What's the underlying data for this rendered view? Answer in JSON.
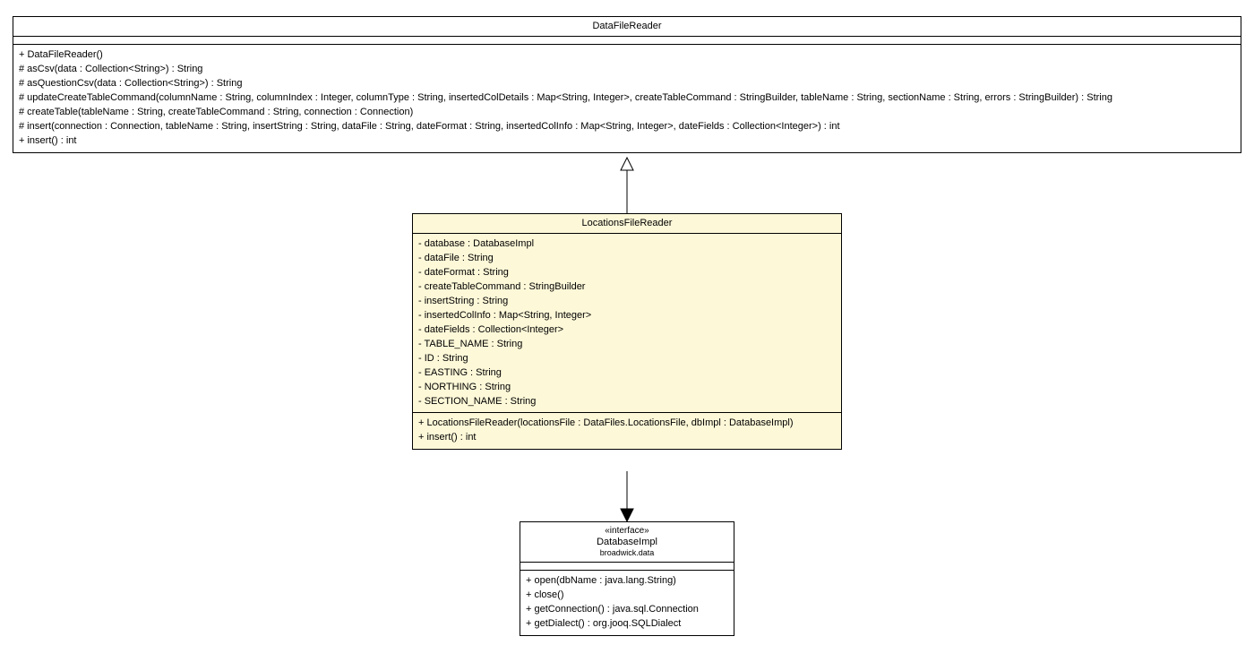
{
  "classes": {
    "dataFileReader": {
      "name": "DataFileReader",
      "attributes": [],
      "operations": [
        "+ DataFileReader()",
        "# asCsv(data : Collection<String>) : String",
        "# asQuestionCsv(data : Collection<String>) : String",
        "# updateCreateTableCommand(columnName : String, columnIndex : Integer, columnType : String, insertedColDetails : Map<String, Integer>, createTableCommand : StringBuilder, tableName : String, sectionName : String, errors : StringBuilder) : String",
        "# createTable(tableName : String, createTableCommand : String, connection : Connection)",
        "# insert(connection : Connection, tableName : String, insertString : String, dataFile : String, dateFormat : String, insertedColInfo : Map<String, Integer>, dateFields : Collection<Integer>) : int",
        "+ insert() : int"
      ]
    },
    "locationsFileReader": {
      "name": "LocationsFileReader",
      "attributes": [
        "- database : DatabaseImpl",
        "- dataFile : String",
        "- dateFormat : String",
        "- createTableCommand : StringBuilder",
        "- insertString : String",
        "- insertedColInfo : Map<String, Integer>",
        "- dateFields : Collection<Integer>",
        "- TABLE_NAME : String",
        "- ID : String",
        "- EASTING : String",
        "- NORTHING : String",
        "- SECTION_NAME : String"
      ],
      "operations": [
        "+ LocationsFileReader(locationsFile : DataFiles.LocationsFile, dbImpl : DatabaseImpl)",
        "+ insert() : int"
      ]
    },
    "databaseImpl": {
      "stereotype": "«interface»",
      "name": "DatabaseImpl",
      "package": "broadwick.data",
      "attributes": [],
      "operations": [
        "+ open(dbName : java.lang.String)",
        "+ close()",
        "+ getConnection() : java.sql.Connection",
        "+ getDialect() : org.jooq.SQLDialect"
      ]
    }
  }
}
